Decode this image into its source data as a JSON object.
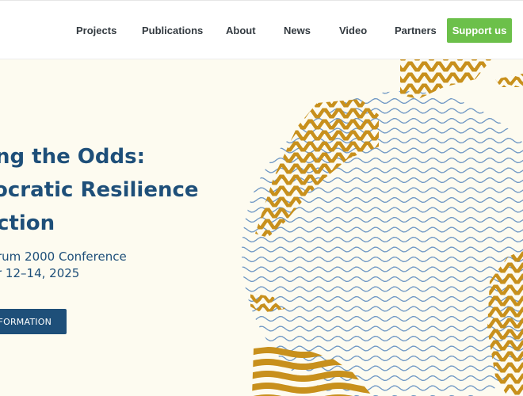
{
  "nav": {
    "items": [
      {
        "label": "Projects"
      },
      {
        "label": "Publications"
      },
      {
        "label": "About"
      },
      {
        "label": "News"
      },
      {
        "label": "Video"
      },
      {
        "label": "Partners"
      }
    ],
    "support_label": "Support us"
  },
  "hero": {
    "title_lines": [
      "ng the Odds:",
      "ocratic Resilience",
      "ction"
    ],
    "subtitle_lines": [
      "rum 2000 Conference",
      "r 12–14, 2025"
    ],
    "button_label": "NFORMATION"
  },
  "colors": {
    "brand_blue": "#1e4f79",
    "support_green": "#6cc04a",
    "wave_blue": "#6f97c4",
    "wave_gold": "#c8901c",
    "background": "#fdfbf0"
  }
}
